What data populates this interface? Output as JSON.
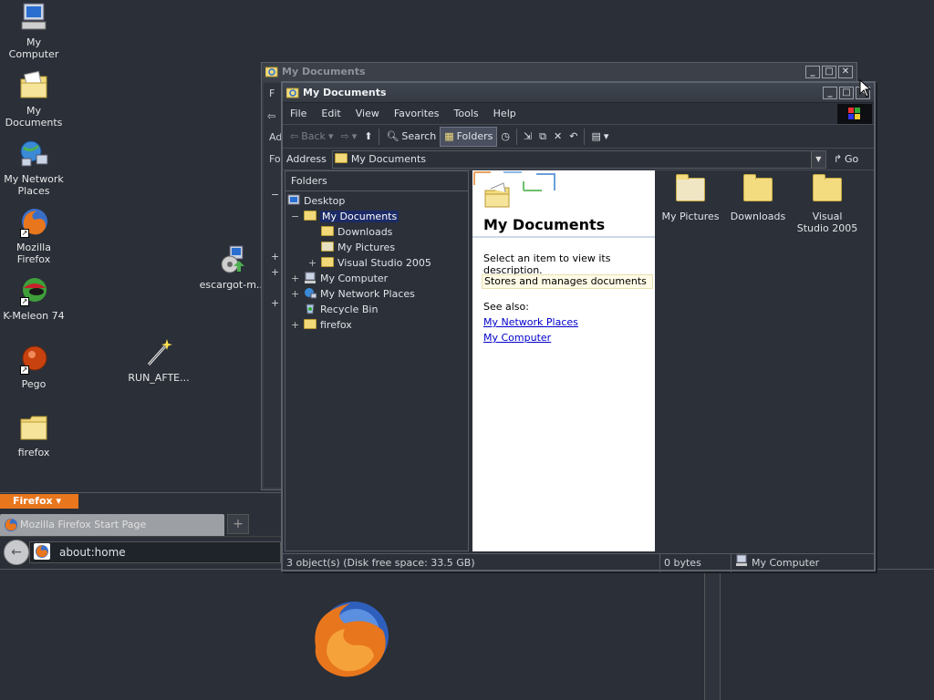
{
  "desktop": {
    "icons": [
      {
        "label": "My Computer"
      },
      {
        "label": "My Documents"
      },
      {
        "label": "My Network Places"
      },
      {
        "label": "Mozilla Firefox"
      },
      {
        "label": "K-Meleon 74"
      },
      {
        "label": "Pego"
      },
      {
        "label": "firefox"
      },
      {
        "label": "escargot-m..."
      },
      {
        "label": "RUN_AFTE..."
      }
    ]
  },
  "firefox": {
    "menu_label": "Firefox",
    "tab_title": "Mozilla Firefox Start Page",
    "new_tab_label": "+",
    "url": "about:home"
  },
  "back_window": {
    "title": "My Documents",
    "labels": [
      "F",
      "Ad",
      "Fo"
    ]
  },
  "window": {
    "title": "My Documents",
    "menu": [
      "File",
      "Edit",
      "View",
      "Favorites",
      "Tools",
      "Help"
    ],
    "toolbar": {
      "back": "Back",
      "search": "Search",
      "folders": "Folders"
    },
    "address": {
      "label": "Address",
      "value": "My Documents",
      "go": "Go"
    },
    "folders_pane": {
      "header": "Folders",
      "tree": [
        {
          "label": "Desktop"
        },
        {
          "label": "My Documents",
          "expander": "−"
        },
        {
          "label": "Downloads"
        },
        {
          "label": "My Pictures"
        },
        {
          "label": "Visual Studio 2005",
          "expander": "+"
        },
        {
          "label": "My Computer",
          "expander": "+"
        },
        {
          "label": "My Network Places",
          "expander": "+"
        },
        {
          "label": "Recycle Bin"
        },
        {
          "label": "firefox",
          "expander": "+"
        }
      ]
    },
    "info_pane": {
      "title": "My Documents",
      "description": "Select an item to view its description.",
      "tooltip": "Stores and manages documents",
      "see_also": "See also:",
      "links": [
        "My Network Places",
        "My Computer"
      ]
    },
    "content": {
      "items": [
        {
          "label": "My Pictures"
        },
        {
          "label": "Downloads"
        },
        {
          "label": "Visual Studio 2005"
        }
      ]
    },
    "status": {
      "objects": "3 object(s) (Disk free space: 33.5 GB)",
      "size": "0 bytes",
      "zone": "My Computer"
    }
  },
  "colors": {
    "desktop_bg": "#2a2f38",
    "firefox_menu": "#e8761d",
    "selection": "#1c2a66",
    "folder": "#f3dc80"
  }
}
